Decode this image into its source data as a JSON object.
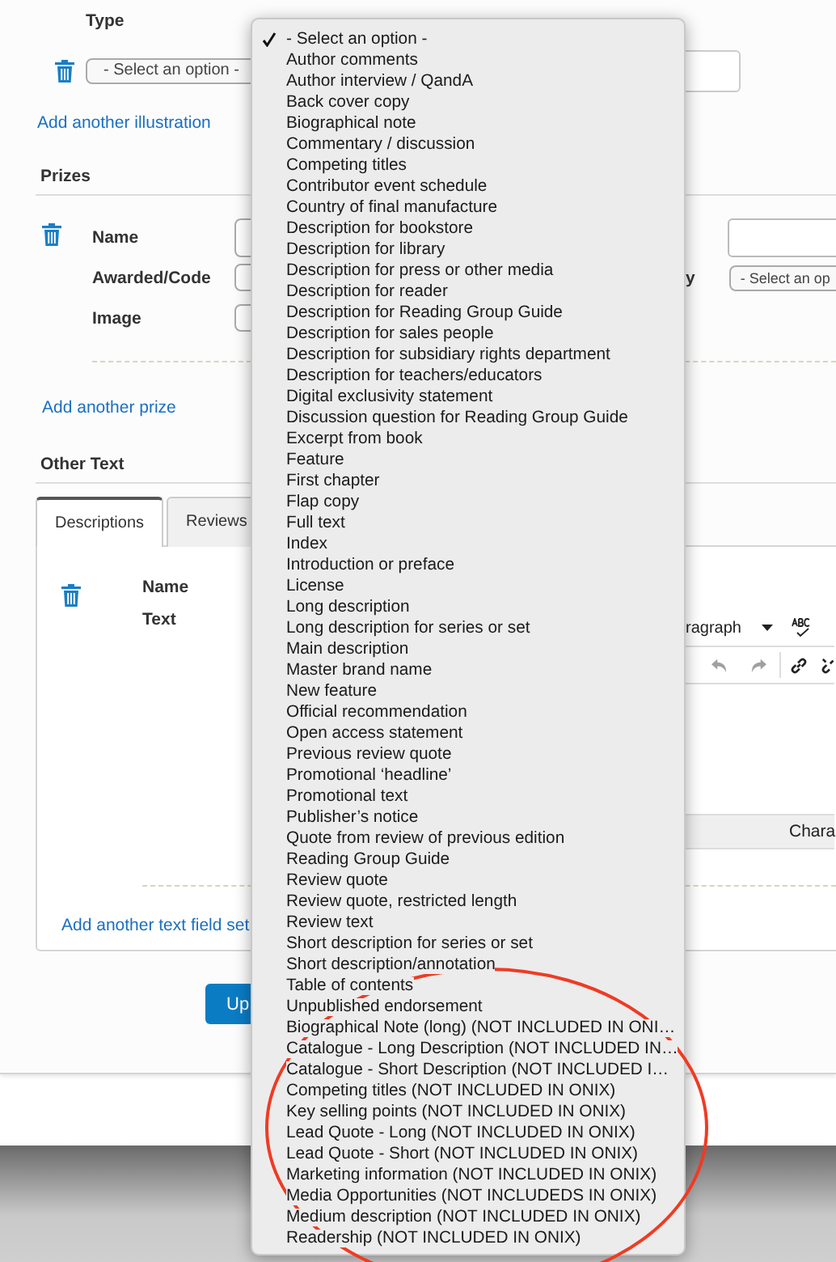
{
  "illustrations": {
    "type_label": "Type",
    "select_value": "- Select an option -",
    "add_link": "Add another illustration"
  },
  "prizes": {
    "title": "Prizes",
    "fields": [
      {
        "label": "Name",
        "right": {
          "kind": "input"
        }
      },
      {
        "label": "Awarded/Code",
        "right": {
          "kind": "select",
          "label": "y",
          "value": "- Select an op"
        }
      },
      {
        "label": "Image"
      }
    ],
    "add_link": "Add another prize"
  },
  "other_text": {
    "title": "Other Text",
    "tabs": [
      {
        "label": "Descriptions",
        "selected": true
      },
      {
        "label": "Reviews",
        "selected": false
      }
    ],
    "fields": [
      {
        "label": "Name"
      },
      {
        "label": "Text"
      }
    ],
    "format_select": "ragraph",
    "char_bar": "Chara",
    "add_link": "Add another text field set"
  },
  "submit_button": "Up",
  "dropdown": {
    "options": [
      {
        "label": "- Select an option -",
        "selected": true
      },
      {
        "label": "Author comments",
        "selected": false
      },
      {
        "label": "Author interview / QandA",
        "selected": false
      },
      {
        "label": "Back cover copy",
        "selected": false
      },
      {
        "label": "Biographical note",
        "selected": false
      },
      {
        "label": "Commentary / discussion",
        "selected": false
      },
      {
        "label": "Competing titles",
        "selected": false
      },
      {
        "label": "Contributor event schedule",
        "selected": false
      },
      {
        "label": "Country of final manufacture",
        "selected": false
      },
      {
        "label": "Description for bookstore",
        "selected": false
      },
      {
        "label": "Description for library",
        "selected": false
      },
      {
        "label": "Description for press or other media",
        "selected": false
      },
      {
        "label": "Description for reader",
        "selected": false
      },
      {
        "label": "Description for Reading Group Guide",
        "selected": false
      },
      {
        "label": "Description for sales people",
        "selected": false
      },
      {
        "label": "Description for subsidiary rights department",
        "selected": false
      },
      {
        "label": "Description for teachers/educators",
        "selected": false
      },
      {
        "label": "Digital exclusivity statement",
        "selected": false
      },
      {
        "label": "Discussion question for Reading Group Guide",
        "selected": false
      },
      {
        "label": "Excerpt from book",
        "selected": false
      },
      {
        "label": "Feature",
        "selected": false
      },
      {
        "label": "First chapter",
        "selected": false
      },
      {
        "label": "Flap copy",
        "selected": false
      },
      {
        "label": "Full text",
        "selected": false
      },
      {
        "label": "Index",
        "selected": false
      },
      {
        "label": "Introduction or preface",
        "selected": false
      },
      {
        "label": "License",
        "selected": false
      },
      {
        "label": "Long description",
        "selected": false
      },
      {
        "label": "Long description for series or set",
        "selected": false
      },
      {
        "label": "Main description",
        "selected": false
      },
      {
        "label": "Master brand name",
        "selected": false
      },
      {
        "label": "New feature",
        "selected": false
      },
      {
        "label": "Official recommendation",
        "selected": false
      },
      {
        "label": "Open access statement",
        "selected": false
      },
      {
        "label": "Previous review quote",
        "selected": false
      },
      {
        "label": "Promotional ‘headline’",
        "selected": false
      },
      {
        "label": "Promotional text",
        "selected": false
      },
      {
        "label": "Publisher’s notice",
        "selected": false
      },
      {
        "label": "Quote from review of previous edition",
        "selected": false
      },
      {
        "label": "Reading Group Guide",
        "selected": false
      },
      {
        "label": "Review quote",
        "selected": false
      },
      {
        "label": "Review quote, restricted length",
        "selected": false
      },
      {
        "label": "Review text",
        "selected": false
      },
      {
        "label": "Short description for series or set",
        "selected": false
      },
      {
        "label": "Short description/annotation",
        "selected": false
      },
      {
        "label": "Table of contents",
        "selected": false
      },
      {
        "label": "Unpublished endorsement",
        "selected": false
      },
      {
        "label": "Biographical Note (long) (NOT INCLUDED IN ONI…",
        "selected": false
      },
      {
        "label": "Catalogue - Long Description (NOT INCLUDED IN…",
        "selected": false
      },
      {
        "label": "Catalogue - Short Description (NOT INCLUDED I…",
        "selected": false
      },
      {
        "label": "Competing titles (NOT INCLUDED IN ONIX)",
        "selected": false
      },
      {
        "label": "Key selling points (NOT INCLUDED IN ONIX)",
        "selected": false
      },
      {
        "label": "Lead Quote - Long (NOT INCLUDED IN ONIX)",
        "selected": false
      },
      {
        "label": "Lead Quote - Short (NOT INCLUDED IN ONIX)",
        "selected": false
      },
      {
        "label": "Marketing information (NOT INCLUDED IN ONIX)",
        "selected": false
      },
      {
        "label": "Media Opportunities (NOT INCLUDEDS IN ONIX)",
        "selected": false
      },
      {
        "label": "Medium description (NOT INCLUDED IN ONIX)",
        "selected": false
      },
      {
        "label": "Readership (NOT INCLUDED IN ONIX)",
        "selected": false
      }
    ]
  }
}
